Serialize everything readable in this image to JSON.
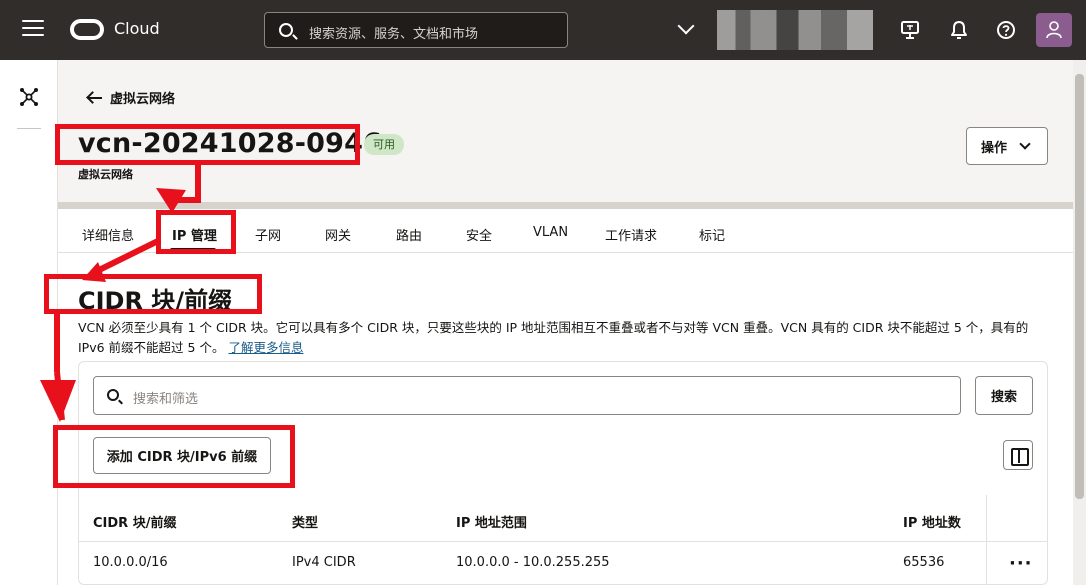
{
  "topbar": {
    "brand": "Cloud",
    "search_placeholder": "搜索资源、服务、文档和市场",
    "icons": [
      "hamburger-menu-icon",
      "oracle-logo-icon",
      "search-icon",
      "chevron-down-icon",
      "monitor-icon",
      "bell-icon",
      "help-icon",
      "user-avatar-icon"
    ]
  },
  "header": {
    "back_label": "虚拟云网络",
    "title": "vcn-20241028-0946",
    "status": "可用",
    "subtitle": "虚拟云网络",
    "actions_label": "操作"
  },
  "tabs": [
    {
      "label": "详细信息",
      "active": false
    },
    {
      "label": "IP 管理",
      "active": true
    },
    {
      "label": "子网",
      "active": false
    },
    {
      "label": "网关",
      "active": false
    },
    {
      "label": "路由",
      "active": false
    },
    {
      "label": "安全",
      "active": false
    },
    {
      "label": "VLAN",
      "active": false
    },
    {
      "label": "工作请求",
      "active": false
    },
    {
      "label": "标记",
      "active": false
    }
  ],
  "section": {
    "title": "CIDR 块/前缀",
    "description": "VCN 必须至少具有 1 个 CIDR 块。它可以具有多个 CIDR 块，只要这些块的 IP 地址范围相互不重叠或者不与对等 VCN 重叠。VCN 具有的 CIDR 块不能超过 5 个，具有的 IPv6 前缀不能超过 5 个。",
    "learn_more": "了解更多信息",
    "filter_placeholder": "搜索和筛选",
    "search_label": "搜索",
    "add_label": "添加 CIDR 块/IPv6 前缀"
  },
  "table": {
    "columns": [
      "CIDR 块/前缀",
      "类型",
      "IP 地址范围",
      "IP 地址数"
    ],
    "rows": [
      {
        "cidr": "10.0.0.0/16",
        "type": "IPv4 CIDR",
        "range": "10.0.0.0 - 10.0.255.255",
        "count": "65536",
        "menu": "···"
      }
    ]
  },
  "colors": {
    "topbar": "#312d2a",
    "annotation_red": "#e8101a",
    "status_badge_bg": "#cfe6c7",
    "link": "#1a5c8a",
    "avatar": "#8b5d8f"
  }
}
